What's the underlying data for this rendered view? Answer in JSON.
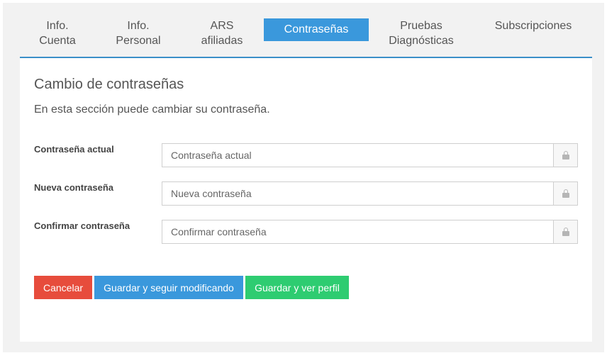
{
  "tabs": [
    {
      "line1": "Info.",
      "line2": "Cuenta"
    },
    {
      "line1": "Info.",
      "line2": "Personal"
    },
    {
      "line1": "ARS",
      "line2": "afiliadas"
    },
    {
      "line1": "Contraseñas",
      "line2": ""
    },
    {
      "line1": "Pruebas",
      "line2": "Diagnósticas"
    },
    {
      "line1": "Subscripciones",
      "line2": ""
    }
  ],
  "active_tab": "Contraseñas",
  "form": {
    "title": "Cambio de contraseñas",
    "subtitle": "En esta sección puede cambiar su contraseña.",
    "fields": [
      {
        "label": "Contraseña actual",
        "placeholder": "Contraseña actual",
        "value": "",
        "icon": "lock-icon"
      },
      {
        "label": "Nueva contraseña",
        "placeholder": "Nueva contraseña",
        "value": "",
        "icon": "lock-icon"
      },
      {
        "label": "Confirmar contraseña",
        "placeholder": "Confirmar contraseña",
        "value": "",
        "icon": "lock-icon"
      }
    ]
  },
  "buttons": {
    "cancel": "Cancelar",
    "save_continue": "Guardar y seguir modificando",
    "save_view": "Guardar y ver perfil"
  },
  "colors": {
    "accent": "#3a98dc",
    "danger": "#e74c3c",
    "success": "#2ecc71"
  }
}
